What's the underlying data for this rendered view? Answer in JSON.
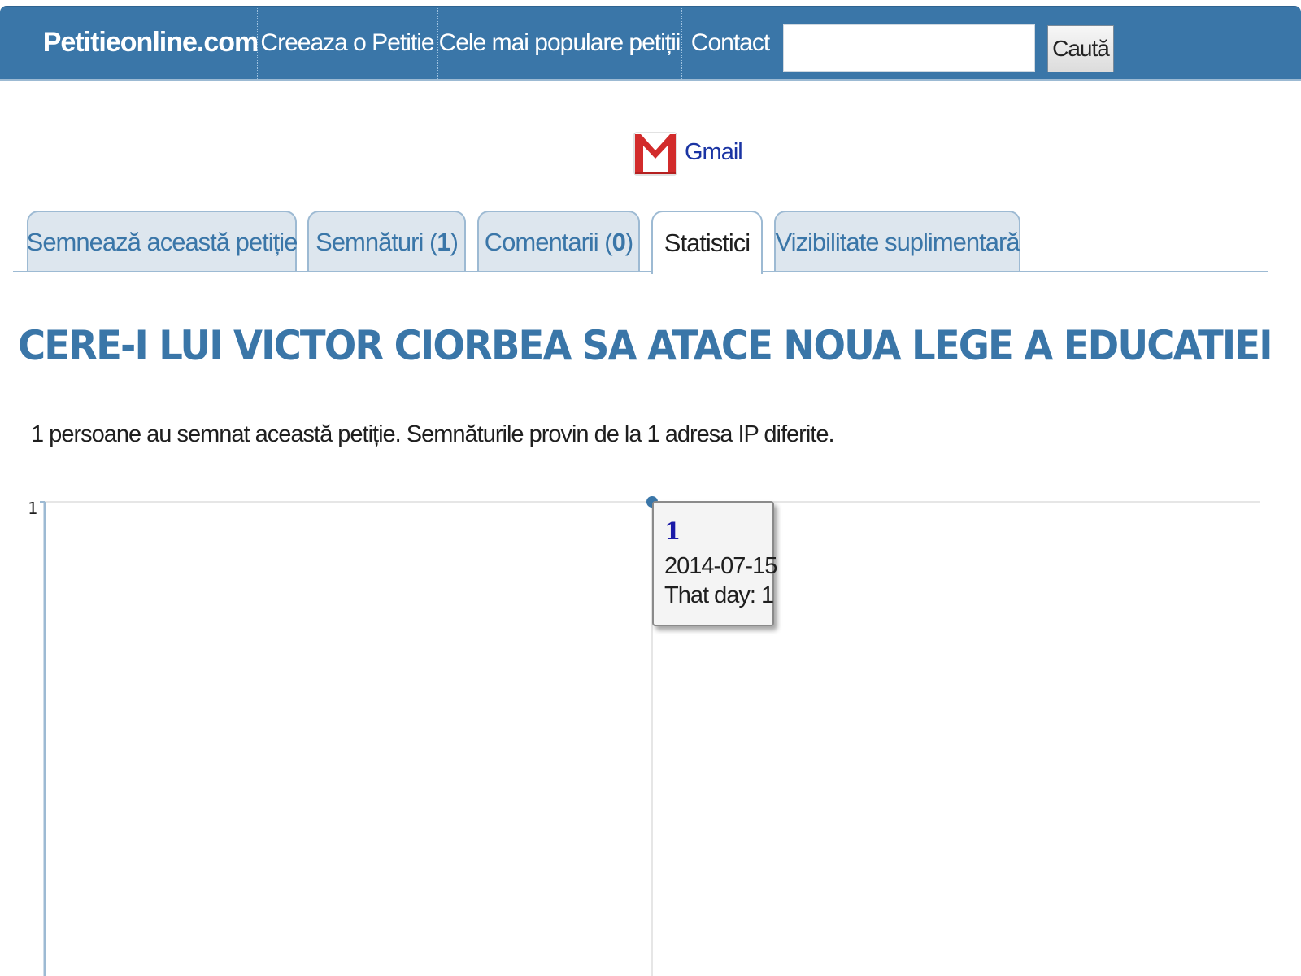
{
  "nav": {
    "logo": "Petitieonline.com",
    "create": "Creeaza o Petitie",
    "popular": "Cele mai populare petiții",
    "contact": "Contact",
    "search_placeholder": "",
    "search_button": "Caută"
  },
  "share": {
    "gmail_label": "Gmail",
    "gmail_icon": "gmail-icon"
  },
  "tabs": [
    {
      "label": "Semnează această petiție",
      "count": null,
      "active": false
    },
    {
      "label": "Semnături",
      "count": "1",
      "active": false
    },
    {
      "label": "Comentarii",
      "count": "0",
      "active": false
    },
    {
      "label": "Statistici",
      "count": null,
      "active": true
    },
    {
      "label": "Vizibilitate suplimentară",
      "count": null,
      "active": false
    }
  ],
  "page_title": "CERE-I LUI VICTOR CIORBEA SA ATACE NOUA LEGE A EDUCATIEI",
  "summary": "1 persoane au semnat această petiție. Semnăturile provin de la 1 adresa IP diferite.",
  "chart_data": {
    "type": "line",
    "x": [
      "2014-07-15"
    ],
    "series": [
      {
        "values": [
          1
        ]
      }
    ],
    "y_tick_labels": [
      "1"
    ],
    "ylim": [
      0,
      1
    ],
    "tooltip": {
      "value": "1",
      "date": "2014-07-15",
      "day_text": "That day: 1"
    },
    "colors": {
      "axis": "#9dbad3",
      "grid": "#e6e6e6",
      "point": "#3a76a8"
    }
  },
  "colors": {
    "brand": "#3a76a8",
    "tab_inactive_bg": "#dde6ee",
    "tab_border": "#9dbad3",
    "link": "#1a34a3"
  }
}
